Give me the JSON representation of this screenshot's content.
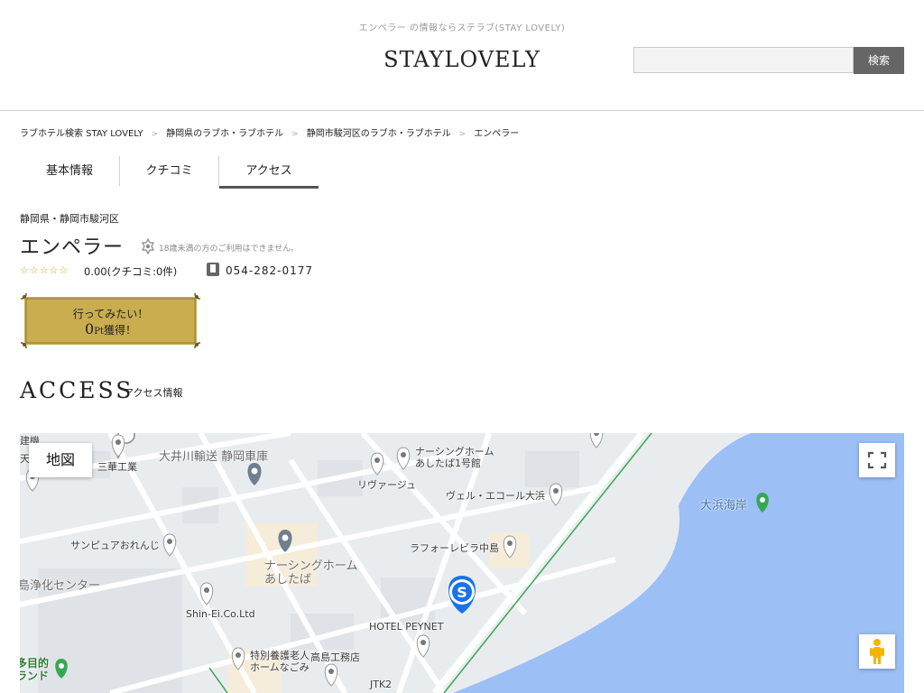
{
  "header": {
    "tagline": "エンペラー の情報ならステラブ(STAY LOVELY)",
    "logo": "STAYLOVELY",
    "search_placeholder": "",
    "search_button": "検索"
  },
  "breadcrumb": [
    "ラブホテル検索 STAY LOVELY",
    "静岡県のラブホ・ラブホテル",
    "静岡市駿河区のラブホ・ラブホテル",
    "エンペラー"
  ],
  "breadcrumb_separator": ">",
  "tabs": [
    {
      "label": "基本情報",
      "active": false
    },
    {
      "label": "クチコミ",
      "active": false
    },
    {
      "label": "アクセス",
      "active": true
    }
  ],
  "hotel": {
    "area": "静岡県・静岡市駿河区",
    "name": "エンペラー",
    "age_notice": "18歳未満の方のご利用はできません。",
    "stars": "☆☆☆☆☆",
    "rating_text": "0.00(クチコミ:0件)",
    "phone": "054-282-0177"
  },
  "wish_button": {
    "line1": "行ってみたい！",
    "line2_big": "0",
    "line2_small": "Pt",
    "line2_rest": "獲得！"
  },
  "access": {
    "title": "ACCESS",
    "subtitle": "アクセス情報"
  },
  "map": {
    "map_type_button": "地図",
    "labels": {
      "kenki": "建機",
      "tenmei": "天明",
      "sanka": "三華工業",
      "oigawa": "大井川輸送 静岡車庫",
      "nursing1": "ナーシングホーム",
      "nursing1b": "あしたば1号館",
      "rivage": "リヴァージュ",
      "vel": "ヴェル・エコール大浜",
      "ohama": "大浜海岸",
      "sunpure": "サンピュアおれんじ",
      "laforet": "ラフォーレビラ中島",
      "nursing2": "ナーシングホーム",
      "nursing2b": "あしたば",
      "jokacenter": "島浄化センター",
      "shinei": "Shin-Ei.Co.Ltd",
      "peynet": "HOTEL PEYNET",
      "tokubetsu1": "特別養護老人",
      "tokubetsu2": "ホームなごみ",
      "takashima": "高島工務店",
      "mokuteki1": "多目的",
      "mokuteki2": "ランド",
      "jtk": "JTK2"
    }
  },
  "colors": {
    "search_button_bg": "#666666",
    "star": "#e0a020",
    "wish_button_gold": "#c9ad4e",
    "map_land": "#e9ecef",
    "map_sea": "#9cbff5",
    "marker_blue": "#1a73e8",
    "park_green": "#34a853"
  }
}
